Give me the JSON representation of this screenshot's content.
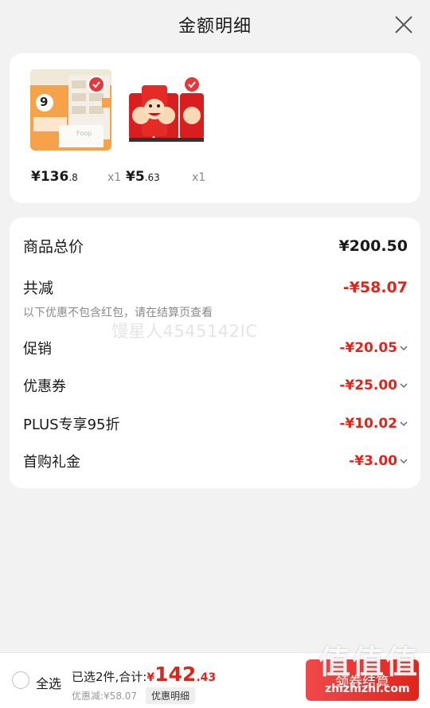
{
  "header": {
    "title": "金额明细"
  },
  "products": [
    {
      "price_symbol": "¥",
      "price_int": "136",
      "price_dec": ".8",
      "qty": "x1",
      "thumb_text_top": "9",
      "thumb_text_bottom": "Foop"
    },
    {
      "price_symbol": "¥",
      "price_int": "5",
      "price_dec": ".63",
      "qty": "x1"
    }
  ],
  "breakdown": {
    "total_label": "商品总价",
    "total_value": "¥200.50",
    "reduce_label": "共减",
    "reduce_value": "-¥58.07",
    "note": "以下优惠不包含红包，请在结算页查看",
    "watermark": "馒星人4545142IC",
    "items": [
      {
        "label": "促销",
        "value": "-¥20.05"
      },
      {
        "label": "优惠券",
        "value": "-¥25.00"
      },
      {
        "label": "PLUS专享95折",
        "value": "-¥10.02"
      },
      {
        "label": "首购礼金",
        "value": "-¥3.00"
      }
    ]
  },
  "bottom": {
    "select_all": "全选",
    "summary_text": "已选2件,合计:",
    "total_symbol": "¥",
    "total_int": "142",
    "total_dec": ".43",
    "discount_text": "优惠减:¥58.07",
    "detail_tag": "优惠明细",
    "checkout": "领券结算"
  },
  "site_logo": {
    "big": "值值值",
    "small": "zhizhizhi.com"
  },
  "colors": {
    "accent": "#e2231a",
    "background": "#f2f2f2"
  }
}
